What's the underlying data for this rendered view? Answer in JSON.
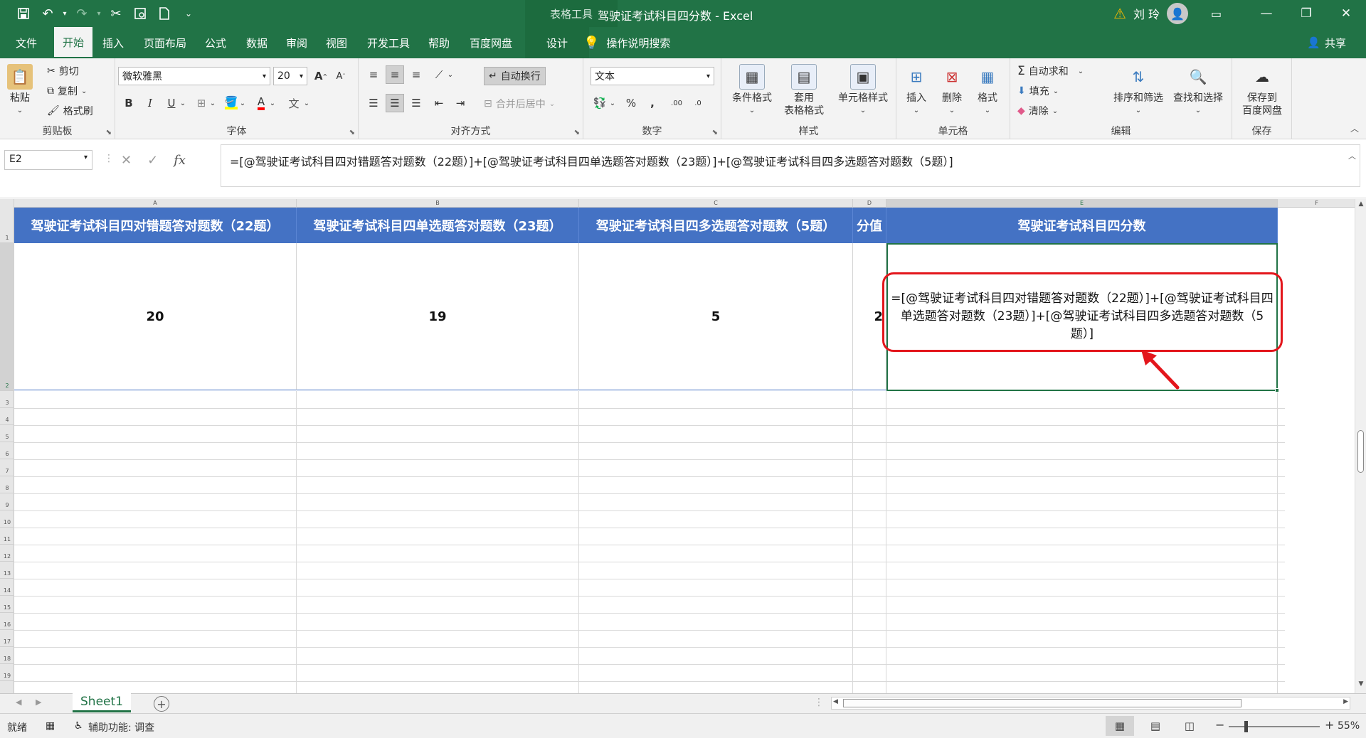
{
  "window": {
    "context_tools": "表格工具",
    "title": "驾驶证考试科目四分数  -  Excel",
    "user_name": "刘 玲"
  },
  "tabs": [
    {
      "label": "文件"
    },
    {
      "label": "开始"
    },
    {
      "label": "插入"
    },
    {
      "label": "页面布局"
    },
    {
      "label": "公式"
    },
    {
      "label": "数据"
    },
    {
      "label": "审阅"
    },
    {
      "label": "视图"
    },
    {
      "label": "开发工具"
    },
    {
      "label": "帮助"
    },
    {
      "label": "百度网盘"
    },
    {
      "label": "设计"
    }
  ],
  "tell_me": "操作说明搜索",
  "share": "共享",
  "ribbon": {
    "clipboard": {
      "paste": "粘贴",
      "cut": "剪切",
      "copy": "复制",
      "format_painter": "格式刷",
      "label": "剪贴板"
    },
    "font": {
      "name": "微软雅黑",
      "size": "20",
      "label": "字体",
      "bold": "B",
      "italic": "I",
      "underline": "U",
      "grow": "A",
      "shrink": "A",
      "font_color": "A"
    },
    "alignment": {
      "wrap_text": "自动换行",
      "merge_center": "合并后居中",
      "label": "对齐方式"
    },
    "number": {
      "format": "文本",
      "percent": "%",
      "comma": ",",
      "label": "数字"
    },
    "styles": {
      "conditional": "条件格式",
      "table_format": "套用\n表格格式",
      "cell_styles": "单元格样式",
      "label": "样式"
    },
    "cells": {
      "insert": "插入",
      "delete": "删除",
      "format": "格式",
      "label": "单元格"
    },
    "editing": {
      "autosum": "自动求和",
      "fill": "填充",
      "clear": "清除",
      "sort_filter": "排序和筛选",
      "find_select": "查找和选择",
      "label": "编辑"
    },
    "save": {
      "save_to_baidu": "保存到\n百度网盘",
      "label": "保存"
    }
  },
  "formula_bar": {
    "name_box": "E2",
    "fx": "fx",
    "formula": "=[@驾驶证考试科目四对错题答对题数（22题）]+[@驾驶证考试科目四单选题答对题数（23题）]+[@驾驶证考试科目四多选题答对题数（5题）]"
  },
  "sheet": {
    "columns": [
      "A",
      "B",
      "C",
      "D",
      "E",
      "F"
    ],
    "rows": [
      "1",
      "2",
      "3",
      "4",
      "5",
      "6",
      "7",
      "8",
      "9",
      "10",
      "11",
      "12",
      "13",
      "14",
      "15",
      "16",
      "17",
      "18",
      "19"
    ],
    "headers": [
      "驾驶证考试科目四对错题答对题数（22题）",
      "驾驶证考试科目四单选题答对题数（23题）",
      "驾驶证考试科目四多选题答对题数（5题）",
      "分值",
      "驾驶证考试科目四分数"
    ],
    "row2": [
      "20",
      "19",
      "5",
      "2"
    ],
    "e2_text": "=[@驾驶证考试科目四对错题答对题数（22题）]+[@驾驶证考试科目四单选题答对题数（23题）]+[@驾驶证考试科目四多选题答对题数（5题）]",
    "tab_name": "Sheet1"
  },
  "status": {
    "ready": "就绪",
    "accessibility": "辅助功能: 调查",
    "zoom": "55%"
  },
  "colors": {
    "excel_green": "#217346",
    "header_blue": "#4472c4",
    "annotation_red": "#e3161c"
  }
}
